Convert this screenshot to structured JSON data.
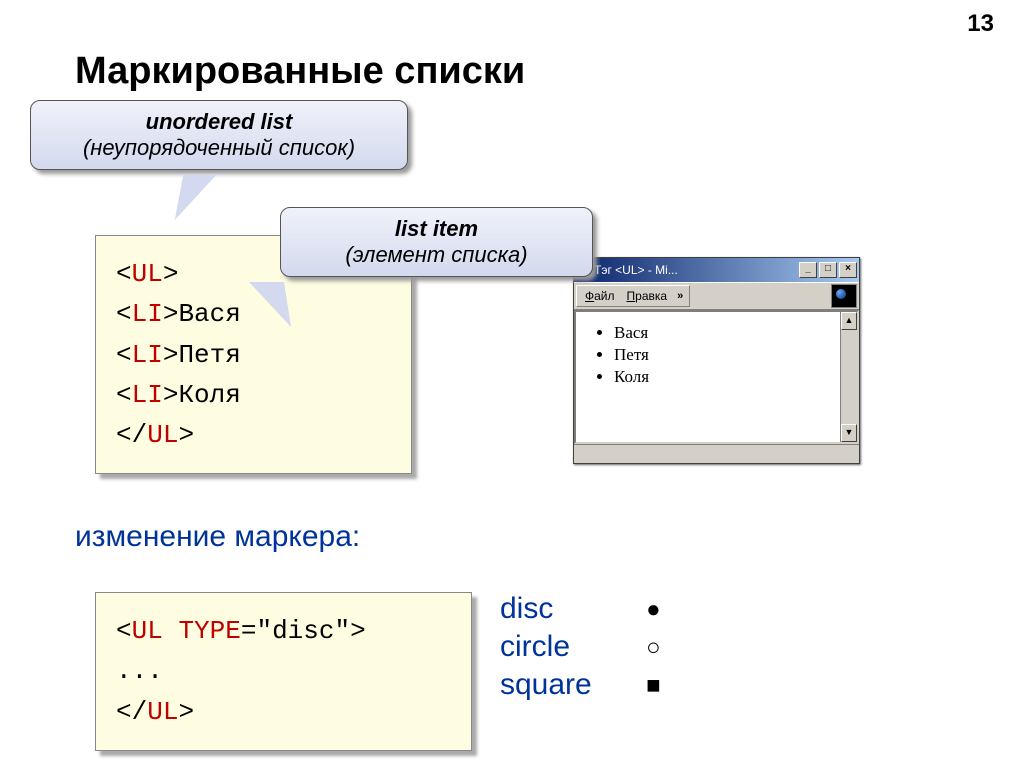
{
  "page_number": "13",
  "title": "Маркированные списки",
  "callout1": {
    "line1": "unordered list",
    "line2": "(неупорядоченный список)"
  },
  "callout2": {
    "line1": "list item",
    "line2": "(элемент списка)"
  },
  "code": {
    "ul_open": "UL",
    "li": "LI",
    "items": [
      "Вася",
      "Петя",
      "Коля"
    ],
    "ul_close": "UL"
  },
  "subtitle": "изменение маркера:",
  "code2": {
    "tag": "UL",
    "attr": "TYPE",
    "val": "\"disc\"",
    "ellipsis": "...",
    "close": "UL"
  },
  "markers": [
    {
      "name": "disc",
      "symbol": "●"
    },
    {
      "name": "circle",
      "symbol": "○"
    },
    {
      "name": "square",
      "symbol": "■"
    }
  ],
  "browser": {
    "title": "Тэг <UL> - Mi...",
    "menu": [
      "Файл",
      "Правка"
    ],
    "chevron": "»",
    "list": [
      "Вася",
      "Петя",
      "Коля"
    ],
    "min": "_",
    "max": "□",
    "close": "×",
    "up": "▲",
    "down": "▼"
  }
}
